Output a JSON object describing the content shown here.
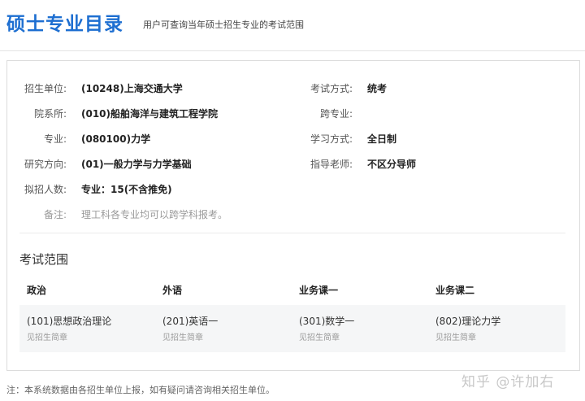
{
  "header": {
    "title": "硕士专业目录",
    "subtitle": "用户可查询当年硕士招生专业的考试范围"
  },
  "info_left": [
    {
      "label": "招生单位:",
      "value": "(10248)上海交通大学"
    },
    {
      "label": "院系所:",
      "value": "(010)船舶海洋与建筑工程学院"
    },
    {
      "label": "专业:",
      "value": "(080100)力学"
    },
    {
      "label": "研究方向:",
      "value": "(01)一般力学与力学基础"
    },
    {
      "label": "拟招人数:",
      "value": "专业：15(不含推免)"
    },
    {
      "label": "备注:",
      "value": "理工科各专业均可以跨学科报考。"
    }
  ],
  "info_right": [
    {
      "label": "考试方式:",
      "value": "统考"
    },
    {
      "label": "跨专业:",
      "value": ""
    },
    {
      "label": "学习方式:",
      "value": "全日制"
    },
    {
      "label": "指导老师:",
      "value": "不区分导师"
    }
  ],
  "scope": {
    "title": "考试范围",
    "headers": [
      "政治",
      "外语",
      "业务课一",
      "业务课二"
    ],
    "subjects": [
      {
        "name": "(101)思想政治理论",
        "note": "见招生简章"
      },
      {
        "name": "(201)英语一",
        "note": "见招生简章"
      },
      {
        "name": "(301)数学一",
        "note": "见招生简章"
      },
      {
        "name": "(802)理论力学",
        "note": "见招生简章"
      }
    ]
  },
  "footer": "注：本系统数据由各招生单位上报，如有疑问请咨询相关招生单位。",
  "watermark": "知乎 @许加右"
}
